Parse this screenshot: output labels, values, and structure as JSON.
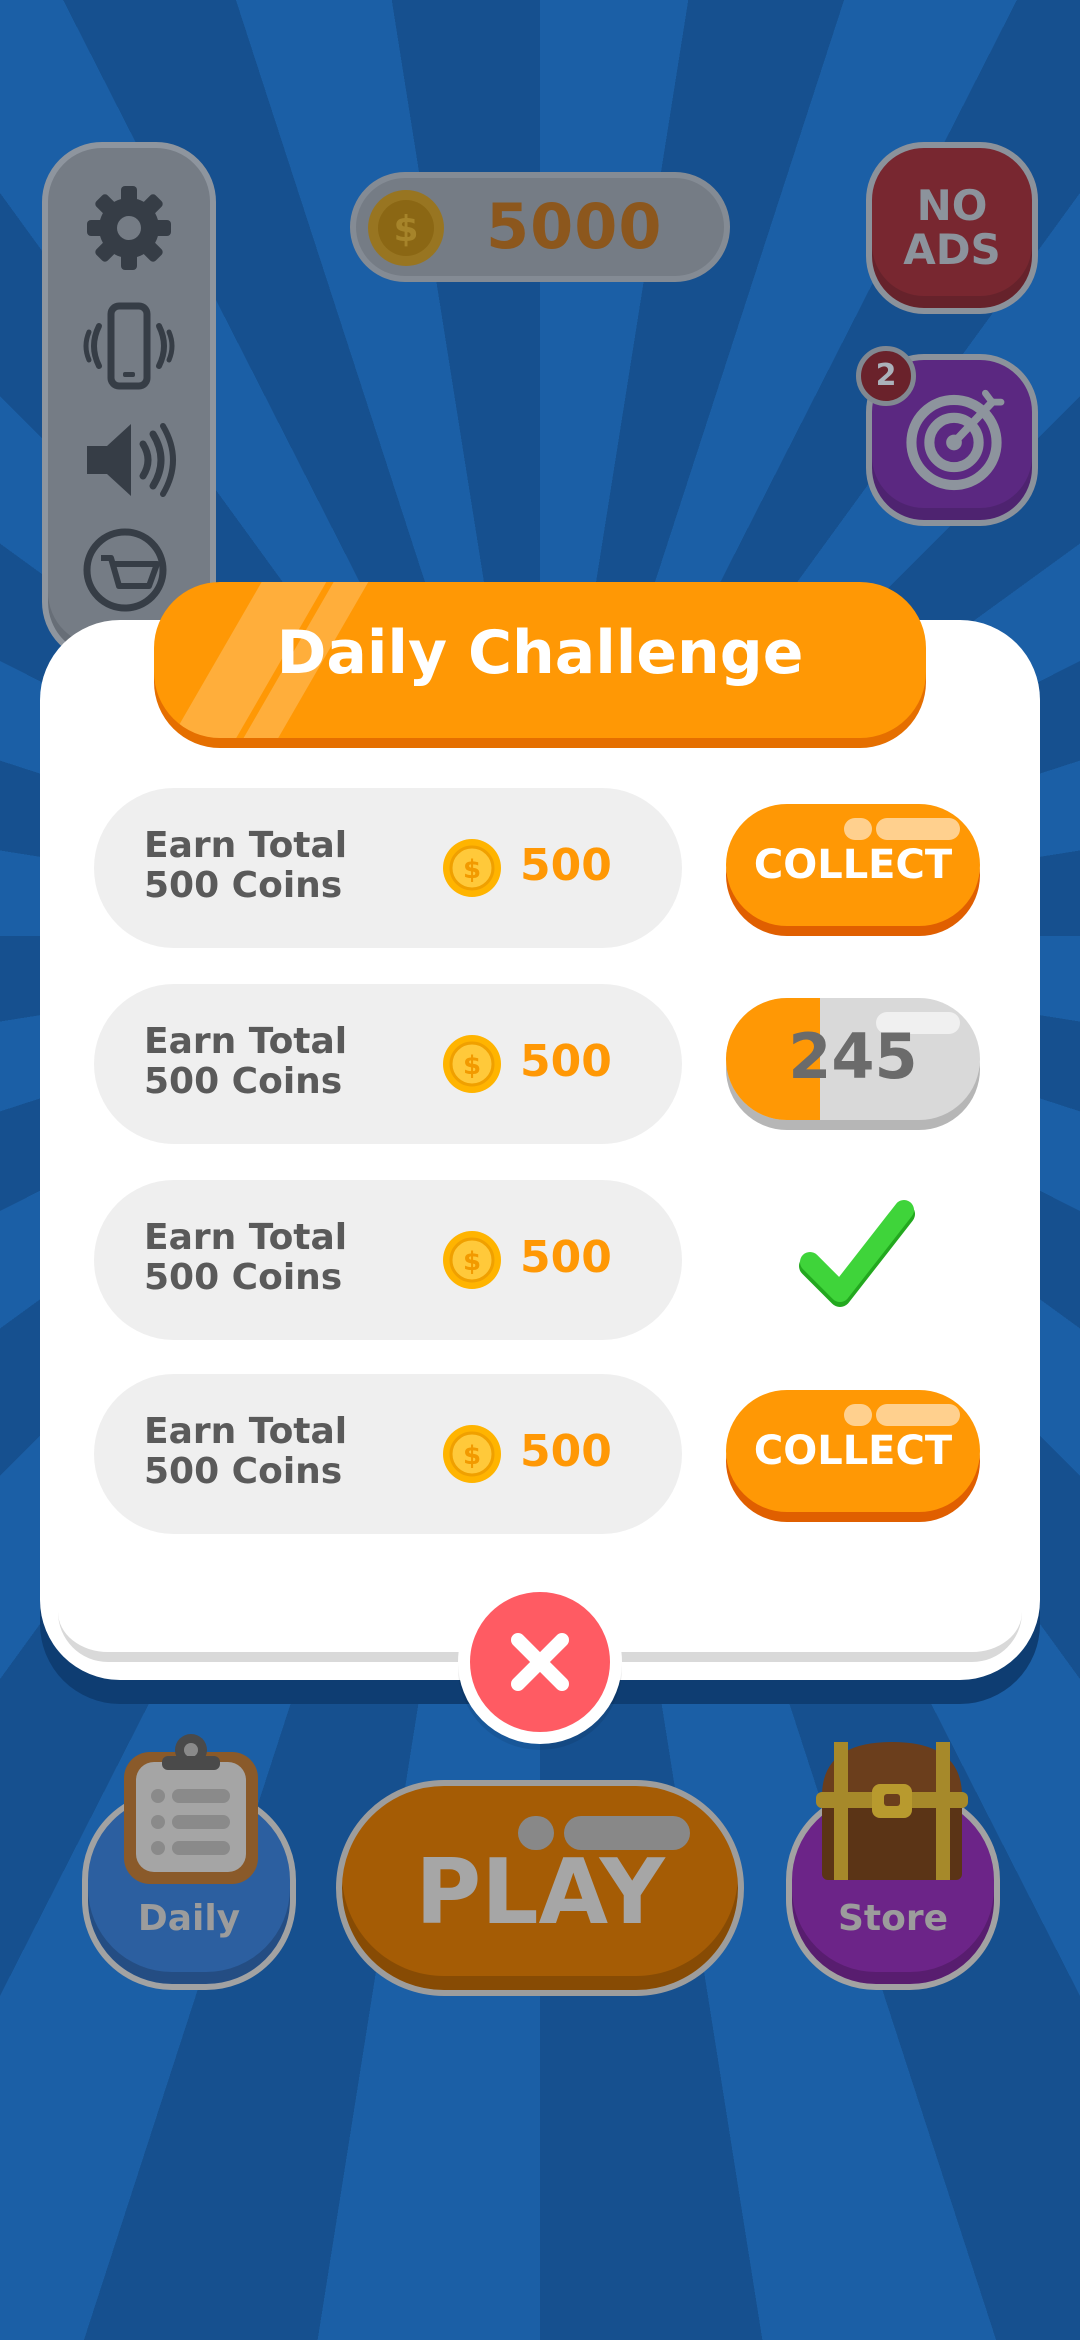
{
  "header": {
    "coins": "5000",
    "no_ads_line1": "NO",
    "no_ads_line2": "ADS",
    "target_badge": "2"
  },
  "modal": {
    "title": "Daily Challenge",
    "challenges": [
      {
        "task_line1": "Earn Total",
        "task_line2": "500 Coins",
        "reward": "500",
        "state": "collect",
        "action_label": "COLLECT"
      },
      {
        "task_line1": "Earn Total",
        "task_line2": "500 Coins",
        "reward": "500",
        "state": "progress",
        "progress_text": "245",
        "progress_fraction": 0.37
      },
      {
        "task_line1": "Earn Total",
        "task_line2": "500 Coins",
        "reward": "500",
        "state": "done"
      },
      {
        "task_line1": "Earn Total",
        "task_line2": "500 Coins",
        "reward": "500",
        "state": "collect",
        "action_label": "COLLECT"
      }
    ]
  },
  "bottom": {
    "daily_label": "Daily",
    "play_label": "PLAY",
    "store_label": "Store"
  },
  "colors": {
    "accent_orange": "#ff9805",
    "close_red": "#ff5b63",
    "check_green": "#3fd43a",
    "background_blue": "#1a5fa8"
  },
  "icons": [
    "settings-gear-icon",
    "vibration-phone-icon",
    "speaker-icon",
    "cart-icon",
    "coin-icon",
    "target-icon",
    "check-icon",
    "close-icon",
    "clipboard-icon",
    "treasure-chest-icon"
  ]
}
